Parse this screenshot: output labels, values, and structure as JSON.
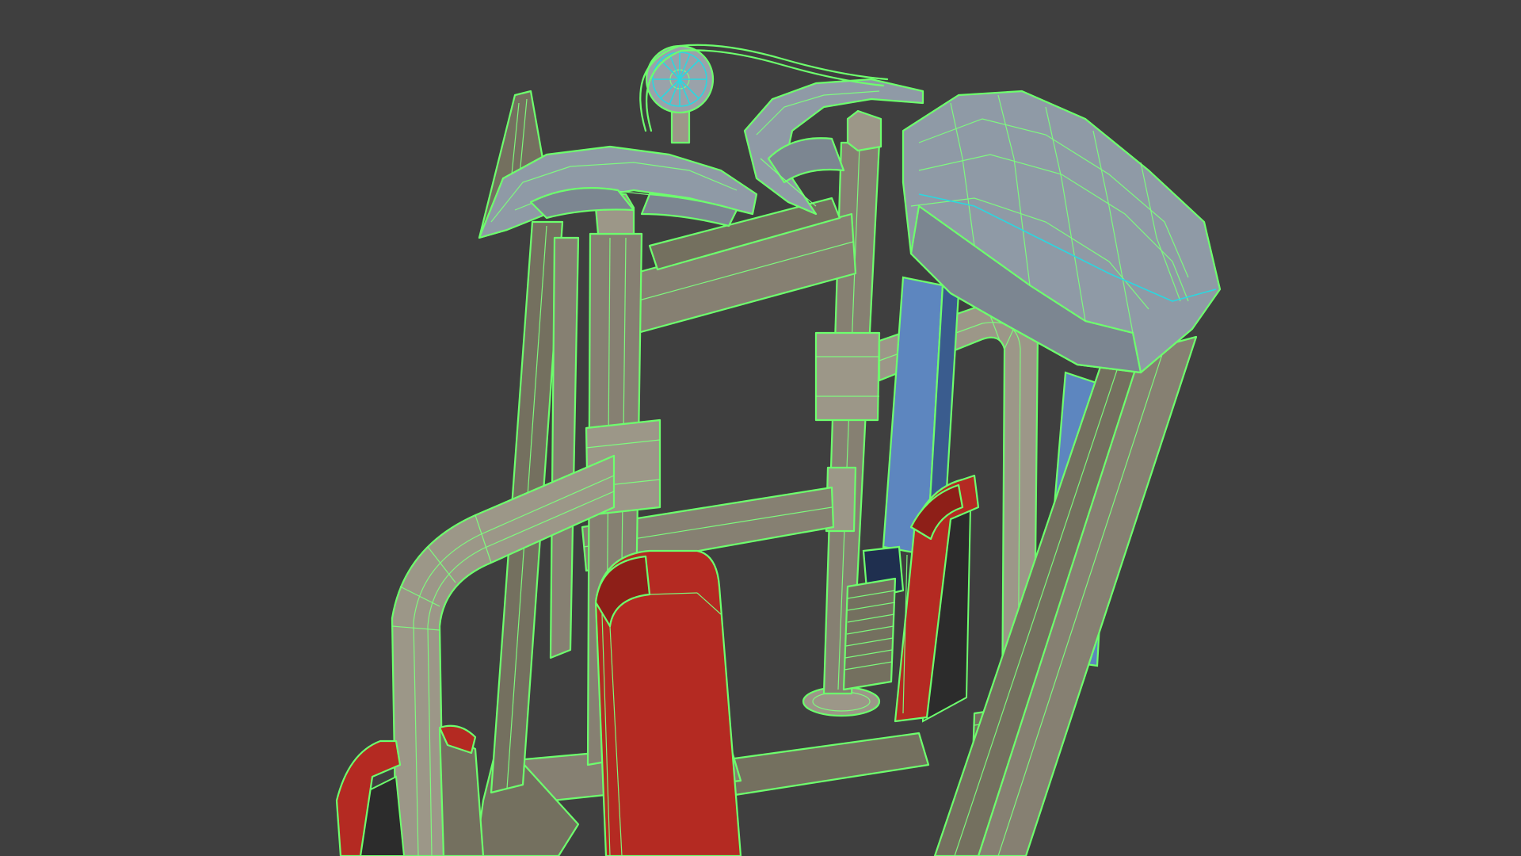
{
  "viewport": {
    "background_color": "#3f3f3f",
    "wireframe_color": "#6dff6d",
    "selected_edge_color": "#2ad8e0"
  },
  "scene": {
    "subject": "gym-machine-3d-model",
    "colors": {
      "frame": "#868072",
      "seat_pad": "#b42a22",
      "weight_guard": "#5d86bf",
      "weight_stack": "#1f2f4f",
      "shroud": "#8f9aa6"
    }
  }
}
